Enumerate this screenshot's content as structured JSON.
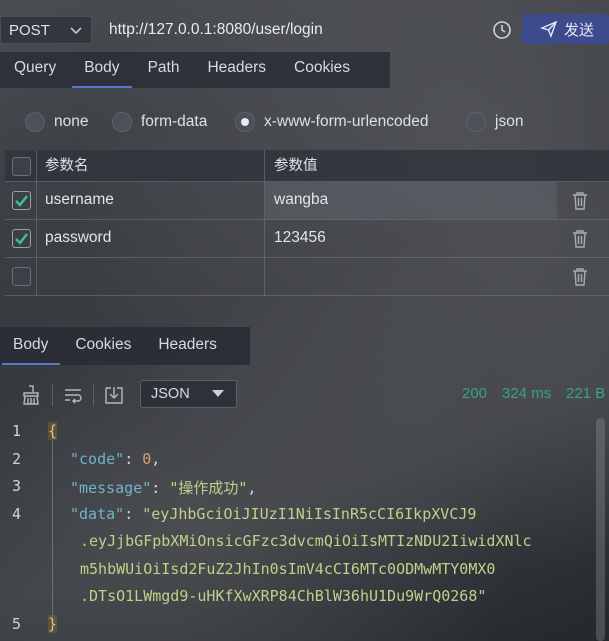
{
  "request": {
    "method": "POST",
    "url": "http://127.0.0.1:8080/user/login",
    "send_label": "发送",
    "tabs": [
      "Query",
      "Body",
      "Path",
      "Headers",
      "Cookies"
    ],
    "active_tab": "Body",
    "body_types": [
      "none",
      "form-data",
      "x-www-form-urlencoded",
      "json"
    ],
    "selected_body_type": "x-www-form-urlencoded",
    "params": {
      "header_name": "参数名",
      "header_value": "参数值",
      "rows": [
        {
          "checked": true,
          "name": "username",
          "value": "wangba"
        },
        {
          "checked": true,
          "name": "password",
          "value": "123456"
        },
        {
          "checked": false,
          "name": "",
          "value": ""
        }
      ]
    }
  },
  "response": {
    "tabs": [
      "Body",
      "Cookies",
      "Headers"
    ],
    "active_tab": "Body",
    "format": "JSON",
    "status": "200",
    "time": "324 ms",
    "size": "221 B",
    "line_numbers": [
      "1",
      "2",
      "3",
      "4",
      "5"
    ],
    "code": {
      "open": "{",
      "k_code": "\"code\"",
      "v_code": "0",
      "k_message": "\"message\"",
      "v_message": "\"操作成功\"",
      "k_data": "\"data\"",
      "v_data_1": "\"eyJhbGciOiJIUzI1NiIsInR5cCI6IkpXVCJ9",
      "v_data_2": ".eyJjbGFpbXMiOnsicGFzc3dvcmQiOiIsMTIzNDU2IiwidXNlc",
      "v_data_3": "m5hbWUiOiIsd2FuZ2JhIn0sImV4cCI6MTc0ODMwMTY0MX0",
      "v_data_4": ".DTsO1LWmgd9-uHKfXwXRP84ChBlW36hU1Du9WrQ0268\"",
      "close": "}"
    }
  },
  "colors": {
    "accent_tab": "#5a78c8",
    "send_button": "#3d4a8c",
    "status_green": "#3aa37a",
    "json_key": "#6fb5c9",
    "json_string": "#c0d089",
    "json_number": "#d8a06a"
  },
  "icons": [
    "chevron-down-icon",
    "clock-icon",
    "send-icon",
    "trash-icon",
    "check-icon",
    "broom-icon",
    "wrap-icon",
    "download-icon"
  ]
}
